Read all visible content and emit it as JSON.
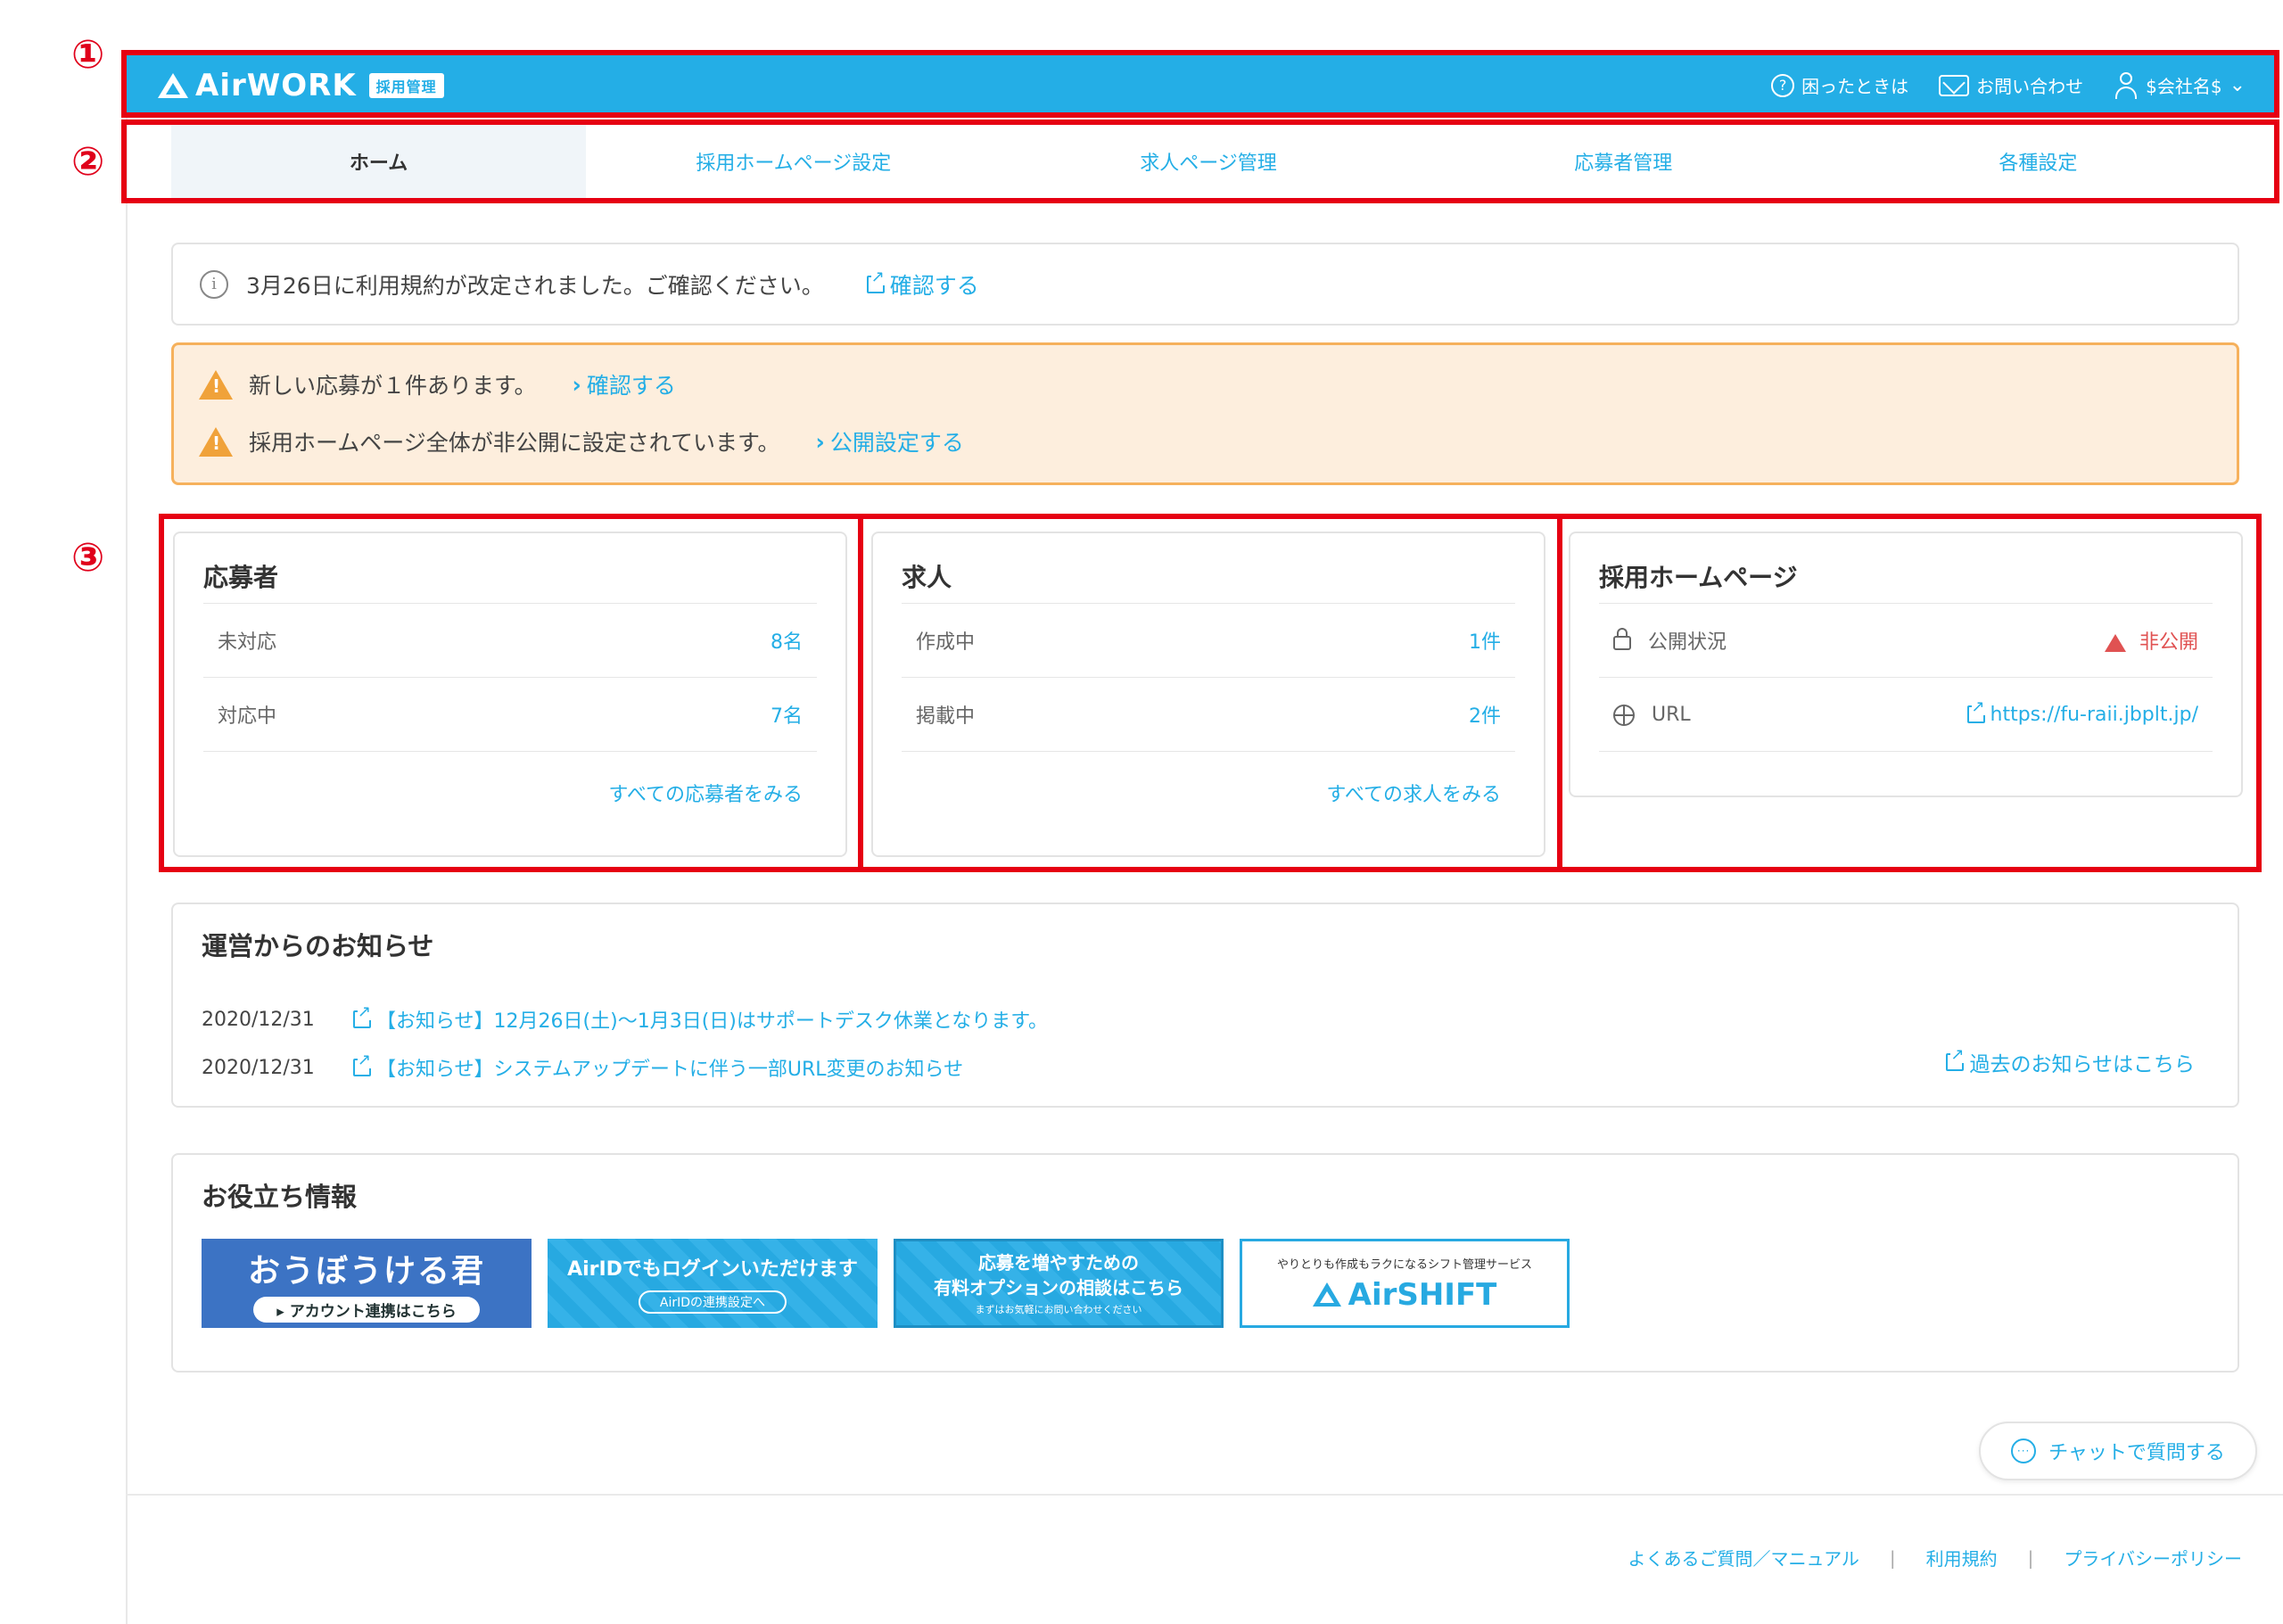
{
  "markers": [
    "①",
    "②",
    "③"
  ],
  "header": {
    "logo": "AirWORK",
    "badge": "採用管理",
    "help": "困ったときは",
    "contact": "お問い合わせ",
    "account": "$会社名$"
  },
  "tabs": [
    {
      "label": "ホーム",
      "active": true
    },
    {
      "label": "採用ホームページ設定",
      "active": false
    },
    {
      "label": "求人ページ管理",
      "active": false
    },
    {
      "label": "応募者管理",
      "active": false
    },
    {
      "label": "各種設定",
      "active": false
    }
  ],
  "notices": {
    "info_text": "3月26日に利用規約が改定されました。ご確認ください。",
    "info_link": "確認する",
    "warn": [
      {
        "text": "新しい応募が１件あります。",
        "link": "確認する"
      },
      {
        "text": "採用ホームページ全体が非公開に設定されています。",
        "link": "公開設定する"
      }
    ]
  },
  "cards": {
    "applicants": {
      "title": "応募者",
      "rows": [
        {
          "label": "未対応",
          "value": "8名"
        },
        {
          "label": "対応中",
          "value": "7名"
        }
      ],
      "footer_link": "すべての応募者をみる"
    },
    "jobs": {
      "title": "求人",
      "rows": [
        {
          "label": "作成中",
          "value": "1件"
        },
        {
          "label": "掲載中",
          "value": "2件"
        }
      ],
      "footer_link": "すべての求人をみる"
    },
    "homepage": {
      "title": "採用ホームページ",
      "status_label": "公開状況",
      "status_value": "非公開",
      "url_label": "URL",
      "url_value": "https://fu-raii.jbplt.jp/"
    }
  },
  "news": {
    "title": "運営からのお知らせ",
    "items": [
      {
        "date": "2020/12/31",
        "text": "【お知らせ】12月26日(土)～1月3日(日)はサポートデスク休業となります。"
      },
      {
        "date": "2020/12/31",
        "text": "【お知らせ】システムアップデートに伴う一部URL変更のお知らせ"
      }
    ],
    "past_link": "過去のお知らせはこちら"
  },
  "useful": {
    "title": "お役立ち情報",
    "banners": {
      "b1_main": "おうぼうける君",
      "b1_sub": "▸ アカウント連携はこちら",
      "b2_main": "AirIDでもログインいただけます",
      "b2_sub": "AirIDの連携設定へ",
      "b3_line1": "応募を増やすための",
      "b3_line2": "有料オプションの相談はこちら",
      "b3_sub": "まずはお気軽にお問い合わせください",
      "b4_sub": "やりとりも作成もラクになるシフト管理サービス",
      "b4_main": "AirSHIFT"
    }
  },
  "chat": "チャットで質問する",
  "footer": {
    "faq": "よくあるご質問／マニュアル",
    "terms": "利用規約",
    "privacy": "プライバシーポリシー"
  },
  "colors": {
    "brand": "#24aee6",
    "warning_bg": "#fdeedd",
    "warning_border": "#f6b15c",
    "annotation_red": "#e60012"
  }
}
